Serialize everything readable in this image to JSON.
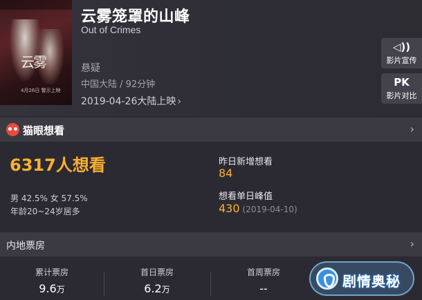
{
  "movie": {
    "title": "云雾笼罩的山峰",
    "en_title": "Out of Crimes",
    "genre": "悬疑",
    "meta": "中国大陆 / 92分钟",
    "release": "2019-04-26大陆上映",
    "poster_title": "云雾",
    "poster_text": "4月26日 警示上映"
  },
  "side_buttons": {
    "promo_icon": "◁))",
    "promo_label": "影片宣传",
    "pk_icon": "PK",
    "pk_label": "影片对比"
  },
  "maoyan": {
    "section_title": "猫眼想看",
    "want_count": "6317人想看",
    "gender": "男 42.5% 女 57.5%",
    "age": "年龄20~24岁居多",
    "new_label": "昨日新增想看",
    "new_value": "84",
    "peak_label": "想看单日峰值",
    "peak_value": "430",
    "peak_date": "(2019-04-10)"
  },
  "box_office": {
    "section_title": "内地票房",
    "total_label": "累计票房",
    "total_value": "9.6",
    "total_unit": "万",
    "first_day_label": "首日票房",
    "first_day_value": "6.2",
    "first_day_unit": "万",
    "first_week_label": "首周票房",
    "first_week_value": "--"
  },
  "watermark": {
    "text": "剧情奥秘"
  },
  "icons": {
    "chevron": "›",
    "release_chevron": "›"
  },
  "colors": {
    "accent": "#fdb12d",
    "background": "#2b2a33",
    "bar": "#3b3a43"
  }
}
